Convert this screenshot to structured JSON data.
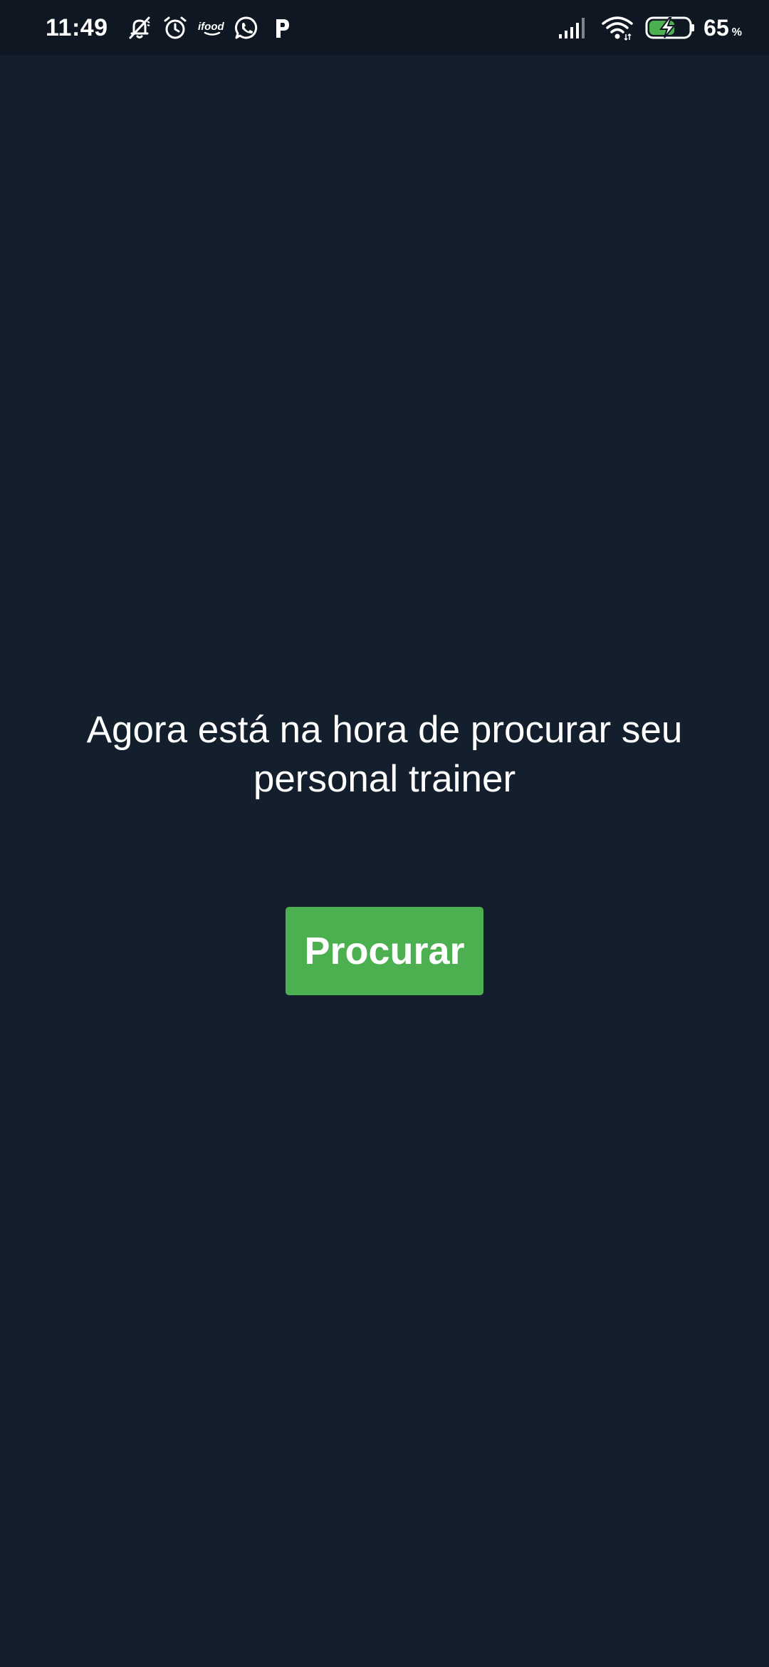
{
  "status_bar": {
    "time": "11:49",
    "notification_icons": [
      "bell-off-icon",
      "alarm-icon",
      "ifood-icon",
      "whatsapp-icon",
      "p-app-icon"
    ],
    "ifood_label": "ifood",
    "battery_percent": "65",
    "battery_unit": "%",
    "battery_level": 0.65,
    "battery_charging": true
  },
  "main": {
    "message": "Agora está na hora de procurar seu personal trainer",
    "search_button_label": "Procurar"
  },
  "colors": {
    "background": "#141f2e",
    "status_bar_background": "#0f1822",
    "button": "#4caf50",
    "battery_fill": "#4caf50"
  }
}
